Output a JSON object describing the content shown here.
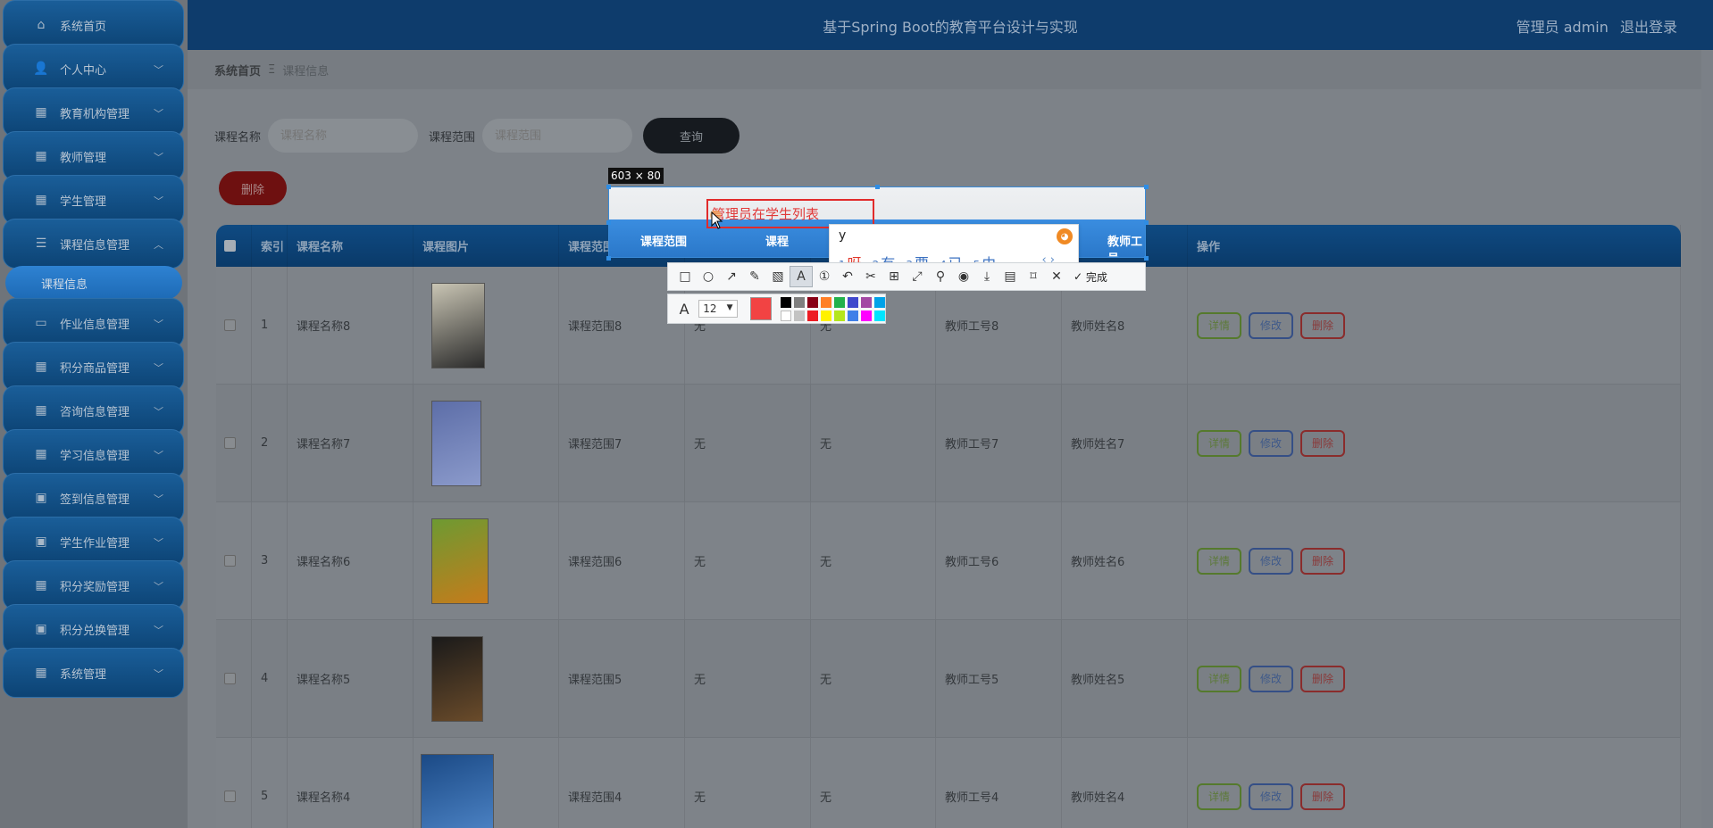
{
  "header": {
    "title": "基于Spring Boot的教育平台设计与实现",
    "user": "管理员 admin",
    "logout": "退出登录"
  },
  "sidebar": {
    "items": [
      {
        "label": "系统首页",
        "icon": "home-icon"
      },
      {
        "label": "个人中心",
        "icon": "user-icon"
      },
      {
        "label": "教育机构管理",
        "icon": "grid-icon"
      },
      {
        "label": "教师管理",
        "icon": "grid-icon"
      },
      {
        "label": "学生管理",
        "icon": "grid-icon"
      },
      {
        "label": "课程信息管理",
        "icon": "sliders-icon"
      },
      {
        "label": "课程信息",
        "icon": ""
      },
      {
        "label": "作业信息管理",
        "icon": "briefcase-icon"
      },
      {
        "label": "积分商品管理",
        "icon": "grid-icon"
      },
      {
        "label": "咨询信息管理",
        "icon": "grid-icon"
      },
      {
        "label": "学习信息管理",
        "icon": "grid-icon"
      },
      {
        "label": "签到信息管理",
        "icon": "clipboard-icon"
      },
      {
        "label": "学生作业管理",
        "icon": "clipboard-icon"
      },
      {
        "label": "积分奖励管理",
        "icon": "grid-icon"
      },
      {
        "label": "积分兑换管理",
        "icon": "clipboard-icon"
      },
      {
        "label": "系统管理",
        "icon": "grid-icon"
      }
    ]
  },
  "breadcrumb": {
    "home": "系统首页",
    "sep": "Ξ",
    "current": "课程信息"
  },
  "search": {
    "course_name_label": "课程名称",
    "course_name_placeholder": "课程名称",
    "course_scope_label": "课程范围",
    "course_scope_placeholder": "课程范围",
    "query_label": "查询"
  },
  "actions": {
    "delete_label": "删除"
  },
  "table": {
    "columns": [
      "",
      "索引",
      "课程名称",
      "课程图片",
      "课程范围",
      "课程",
      "",
      "教师工号",
      "教师姓名",
      "操作"
    ],
    "rows": [
      {
        "index": "1",
        "name": "课程名称8",
        "scope": "课程范围8",
        "c5": "无",
        "c6": "无",
        "teacher_id": "教师工号8",
        "teacher_name": "教师姓名8"
      },
      {
        "index": "2",
        "name": "课程名称7",
        "scope": "课程范围7",
        "c5": "无",
        "c6": "无",
        "teacher_id": "教师工号7",
        "teacher_name": "教师姓名7"
      },
      {
        "index": "3",
        "name": "课程名称6",
        "scope": "课程范围6",
        "c5": "无",
        "c6": "无",
        "teacher_id": "教师工号6",
        "teacher_name": "教师姓名6"
      },
      {
        "index": "4",
        "name": "课程名称5",
        "scope": "课程范围5",
        "c5": "无",
        "c6": "无",
        "teacher_id": "教师工号5",
        "teacher_name": "教师姓名5"
      },
      {
        "index": "5",
        "name": "课程名称4",
        "scope": "课程范围4",
        "c5": "无",
        "c6": "无",
        "teacher_id": "教师工号4",
        "teacher_name": "教师姓名4"
      }
    ],
    "op_detail": "详情",
    "op_edit": "修改",
    "op_delete": "删除"
  },
  "capture": {
    "size": "603 × 80",
    "text": "管理员在学生列表",
    "header_scope": "课程范围",
    "header_course": "课程",
    "header_teacher_id": "教师工号"
  },
  "ime": {
    "composition": "y",
    "candidates": [
      {
        "num": "1",
        "char": "呀"
      },
      {
        "num": "2",
        "char": "有"
      },
      {
        "num": "3",
        "char": "要"
      },
      {
        "num": "4",
        "char": "已"
      },
      {
        "num": "5",
        "char": "由"
      }
    ]
  },
  "toolbar": {
    "done_label": "完成",
    "font_size": "12"
  },
  "colors": {
    "accent": "#2f8de4",
    "annotation_red": "#f24343",
    "palette": [
      "#000000",
      "#7f7f7f",
      "#880015",
      "#ff7f27",
      "#22b14c",
      "#3f48cc",
      "#a349a4",
      "#00a2e8",
      "#ffffff",
      "#c3c3c3",
      "#ed1c24",
      "#fff200",
      "#b5e61d",
      "#3f7fe8",
      "#ff00ff",
      "#00e5ff"
    ]
  }
}
